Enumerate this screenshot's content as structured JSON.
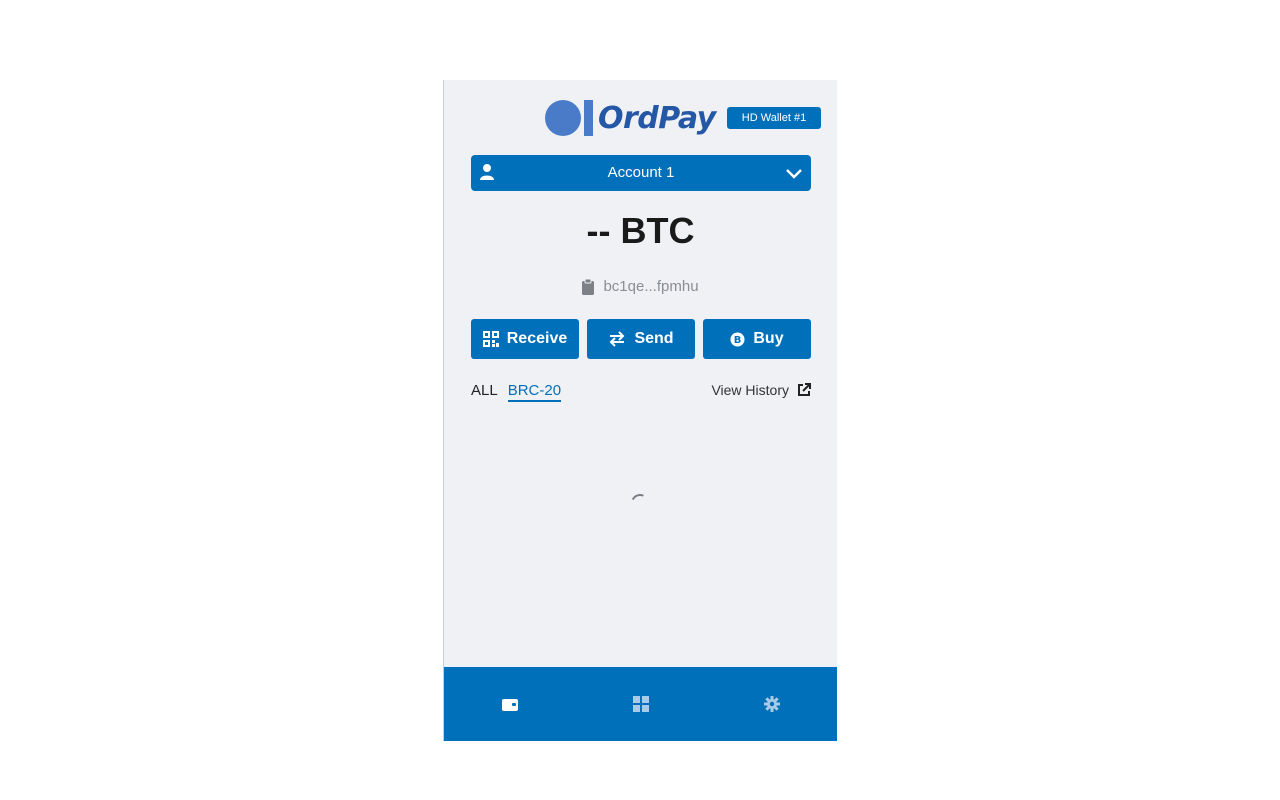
{
  "header": {
    "logo_text": "OrdPay",
    "wallet_badge": "HD Wallet #1"
  },
  "account": {
    "name": "Account 1"
  },
  "balance": {
    "text": "-- BTC"
  },
  "address": {
    "short": "bc1qe...fpmhu"
  },
  "actions": {
    "receive": "Receive",
    "send": "Send",
    "buy": "Buy"
  },
  "tabs": {
    "all": "ALL",
    "brc20": "BRC-20"
  },
  "history": {
    "label": "View History"
  },
  "nav": {
    "items": [
      "wallet-icon",
      "apps-icon",
      "settings-icon"
    ]
  },
  "colors": {
    "primary": "#0170bb",
    "logo": "#4a7bc8",
    "background": "#eff1f5"
  }
}
